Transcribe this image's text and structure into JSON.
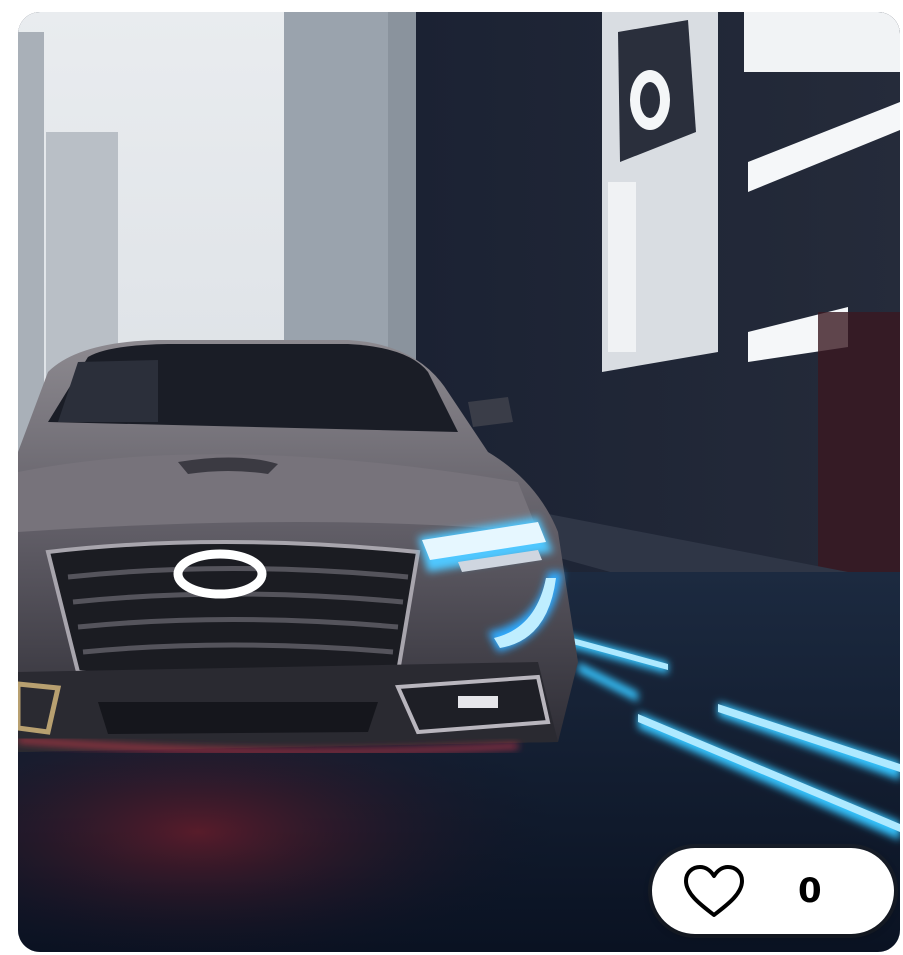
{
  "card": {
    "image_subject": "car-on-neon-city-street",
    "like_button": {
      "icon": "heart-outline-icon",
      "count": "0"
    }
  }
}
